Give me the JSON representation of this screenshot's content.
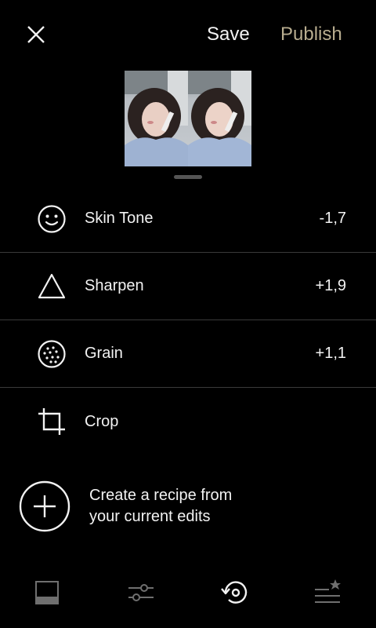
{
  "header": {
    "save_label": "Save",
    "publish_label": "Publish"
  },
  "colors": {
    "background": "#000000",
    "text": "#f2f2f2",
    "publish": "#b8ad8f",
    "divider": "#3a3a3a",
    "icon_inactive": "#6f6f6f"
  },
  "tools": [
    {
      "label": "Skin Tone",
      "value": "-1,7",
      "icon": "face-icon"
    },
    {
      "label": "Sharpen",
      "value": "+1,9",
      "icon": "triangle-icon"
    },
    {
      "label": "Grain",
      "value": "+1,1",
      "icon": "grain-icon"
    },
    {
      "label": "Crop",
      "value": "",
      "icon": "crop-icon"
    }
  ],
  "recipe": {
    "text": "Create a recipe from your current edits",
    "icon": "plus-circle-icon"
  },
  "bottom_nav": [
    {
      "icon": "presets-icon",
      "active": false
    },
    {
      "icon": "adjust-sliders-icon",
      "active": false
    },
    {
      "icon": "history-icon",
      "active": true
    },
    {
      "icon": "recipes-icon",
      "active": false
    }
  ]
}
